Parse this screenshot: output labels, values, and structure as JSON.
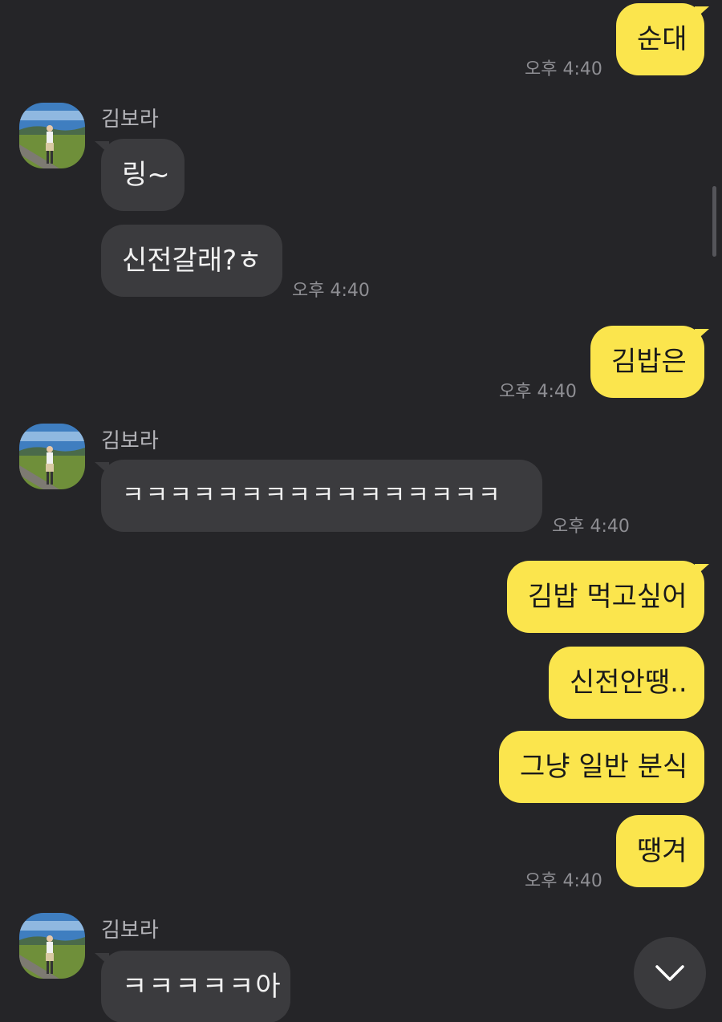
{
  "sender": {
    "name": "김보라"
  },
  "messages": [
    {
      "side": "me",
      "text": "순대"
    },
    {
      "side": "other",
      "text": "링~"
    },
    {
      "side": "other",
      "text": "신전갈래?ㅎ"
    },
    {
      "side": "me",
      "text": "김밥은"
    },
    {
      "side": "other",
      "text": "ㅋㅋㅋㅋㅋㅋㅋㅋㅋㅋㅋㅋㅋㅋㅋㅋ"
    },
    {
      "side": "me",
      "text": "김밥 먹고싶어"
    },
    {
      "side": "me",
      "text": "신전안땡.."
    },
    {
      "side": "me",
      "text": "그냥 일반 분식"
    },
    {
      "side": "me",
      "text": "땡겨"
    },
    {
      "side": "other",
      "text": "ㅋㅋㅋㅋㅋ아"
    }
  ],
  "timestamps": [
    "오후 4:40",
    "오후 4:40",
    "오후 4:40",
    "오후 4:40",
    "오후 4:40"
  ],
  "icons": {
    "scroll_down": "chevron-down-icon",
    "avatar": "profile-photo-landscape"
  },
  "colors": {
    "background": "#252528",
    "my_bubble": "#fbe54d",
    "other_bubble": "#3b3b3e",
    "timestamp": "#8e8e93",
    "sender_name": "#b5b5ba"
  }
}
